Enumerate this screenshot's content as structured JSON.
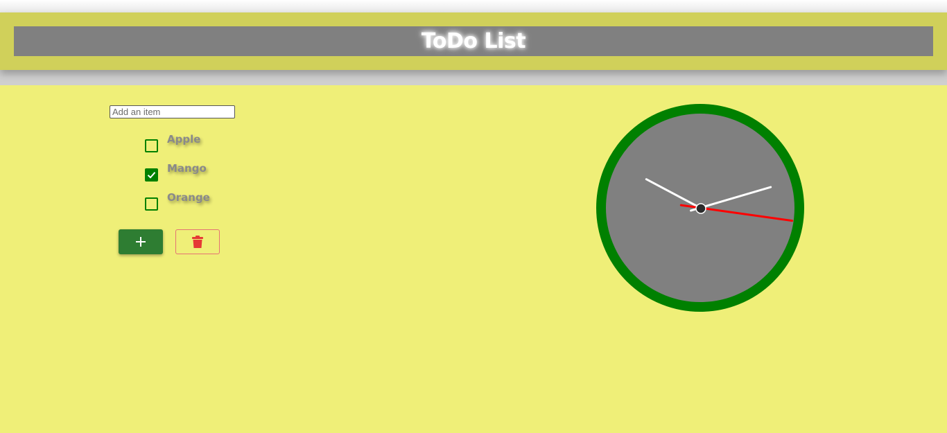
{
  "header": {
    "title": "ToDo List"
  },
  "todo": {
    "input": {
      "value": "",
      "placeholder": "Add an item"
    },
    "items": [
      {
        "label": "Apple",
        "checked": false
      },
      {
        "label": "Mango",
        "checked": true
      },
      {
        "label": "Orange",
        "checked": false
      }
    ],
    "add_button_icon": "plus-icon",
    "delete_button_icon": "trash-icon"
  },
  "clock": {
    "hour": 10,
    "minute": 12,
    "second": 16,
    "colors": {
      "rim": "#008000",
      "face": "#808080",
      "hands": "#ffffff",
      "second_hand": "#ff0000",
      "center": "#2b2b2b"
    }
  },
  "colors": {
    "page_background": "#efef78",
    "header_background": "#d0d05a",
    "header_bar": "#808080",
    "accent_green": "#2e7d32",
    "delete_red": "#e53935"
  }
}
